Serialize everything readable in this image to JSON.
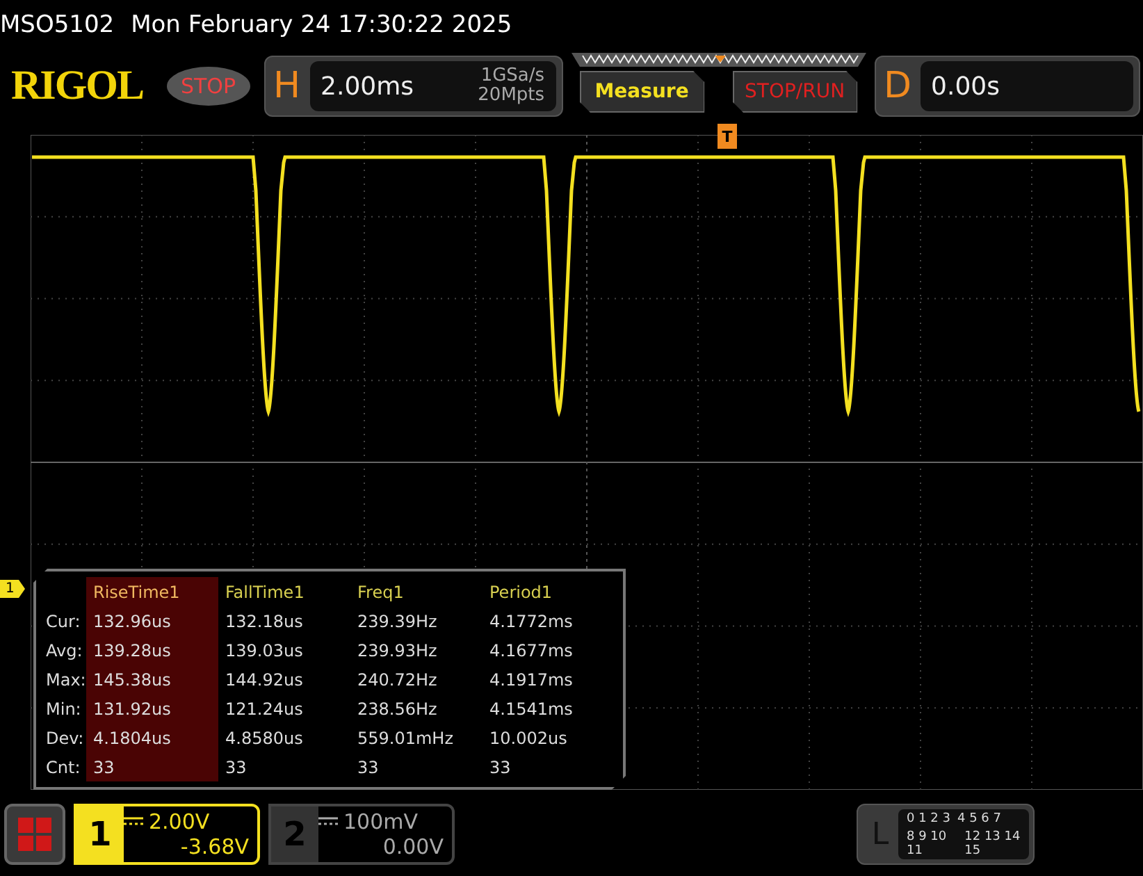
{
  "status_line": {
    "model": "MSO5102",
    "datetime": "Mon February 24 17:30:22 2025"
  },
  "header": {
    "logo": "RIGOL",
    "run_state": "STOP",
    "horizontal": {
      "label": "H",
      "timebase": "2.00ms",
      "sample_rate": "1GSa/s",
      "memory_depth": "20Mpts"
    },
    "buttons": [
      {
        "label": "Measure",
        "kind": "measure"
      },
      {
        "label": "STOP/RUN",
        "kind": "run"
      }
    ],
    "delay": {
      "label": "D",
      "value": "0.00s"
    }
  },
  "screen": {
    "channel_marker": "1",
    "trigger_marker": "T",
    "measurements": {
      "columns": [
        {
          "label": "RiseTime1",
          "selected": true
        },
        {
          "label": "FallTime1",
          "selected": false
        },
        {
          "label": "Freq1",
          "selected": false
        },
        {
          "label": "Period1",
          "selected": false
        }
      ],
      "rows": [
        {
          "label": "Cur:",
          "values": [
            "132.96us",
            "132.18us",
            "239.39Hz",
            "4.1772ms"
          ]
        },
        {
          "label": "Avg:",
          "values": [
            "139.28us",
            "139.03us",
            "239.93Hz",
            "4.1677ms"
          ]
        },
        {
          "label": "Max:",
          "values": [
            "145.38us",
            "144.92us",
            "240.72Hz",
            "4.1917ms"
          ]
        },
        {
          "label": "Min:",
          "values": [
            "131.92us",
            "121.24us",
            "238.56Hz",
            "4.1541ms"
          ]
        },
        {
          "label": "Dev:",
          "values": [
            "4.1804us",
            "4.8580us",
            "559.01mHz",
            "10.002us"
          ]
        },
        {
          "label": "Cnt:",
          "values": [
            "33",
            "33",
            "33",
            "33"
          ]
        }
      ]
    }
  },
  "bottom_bar": {
    "channels": [
      {
        "number": "1",
        "scale": "2.00V",
        "offset": "-3.68V",
        "active": true
      },
      {
        "number": "2",
        "scale": "100mV",
        "offset": "0.00V",
        "active": false
      }
    ],
    "digital": {
      "label": "L",
      "rows": [
        [
          "0 1 2 3",
          "4 5 6 7"
        ],
        [
          "8 9 10 11",
          "12 13 14 15"
        ]
      ]
    }
  }
}
